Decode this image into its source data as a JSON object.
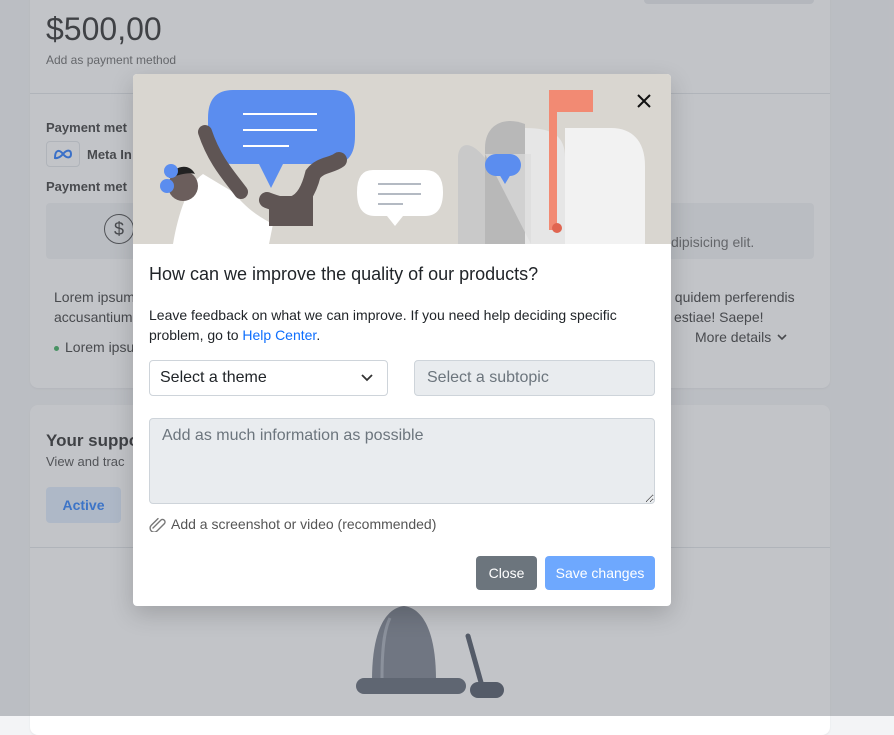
{
  "background": {
    "amount": "$500,00",
    "amount_sub": "Add as payment method",
    "payment_method_label_1": "Payment met",
    "meta_name": "Meta In",
    "payment_method_label_2": "Payment met",
    "info_tail": "dipisicing elit.",
    "lorem_left_1": "Lorem ipsum",
    "lorem_left_2": "accusantium",
    "lorem_left_3": "Lorem ipsu",
    "lorem_right_1": "el quidem perferendis",
    "lorem_right_2": "estiae! Saepe!",
    "more_details": "More details",
    "support_title": "Your suppo",
    "support_sub": "View and trac",
    "tab_active": "Active"
  },
  "modal": {
    "title": "How can we improve the quality of our products?",
    "description_text": "Leave feedback on what we can improve. If you need help deciding specific problem, go to ",
    "help_link": "Help Center",
    "description_end": ".",
    "theme_select": "Select a theme",
    "subtopic_select": "Select a subtopic",
    "textarea_placeholder": "Add as much information as possible",
    "attachment": "Add a screenshot or video (recommended)",
    "close_button": "Close",
    "save_button": "Save changes"
  },
  "colors": {
    "primary": "#0d6efd",
    "save_button": "#6ea8fe",
    "close_button": "#6c757d",
    "hero_background": "#d9d6d0",
    "overlay": "#787c84"
  },
  "icons": [
    "meta-logo-icon",
    "dollar-icon",
    "chevron-down-icon",
    "close-icon",
    "paperclip-icon",
    "bell-icon"
  ]
}
